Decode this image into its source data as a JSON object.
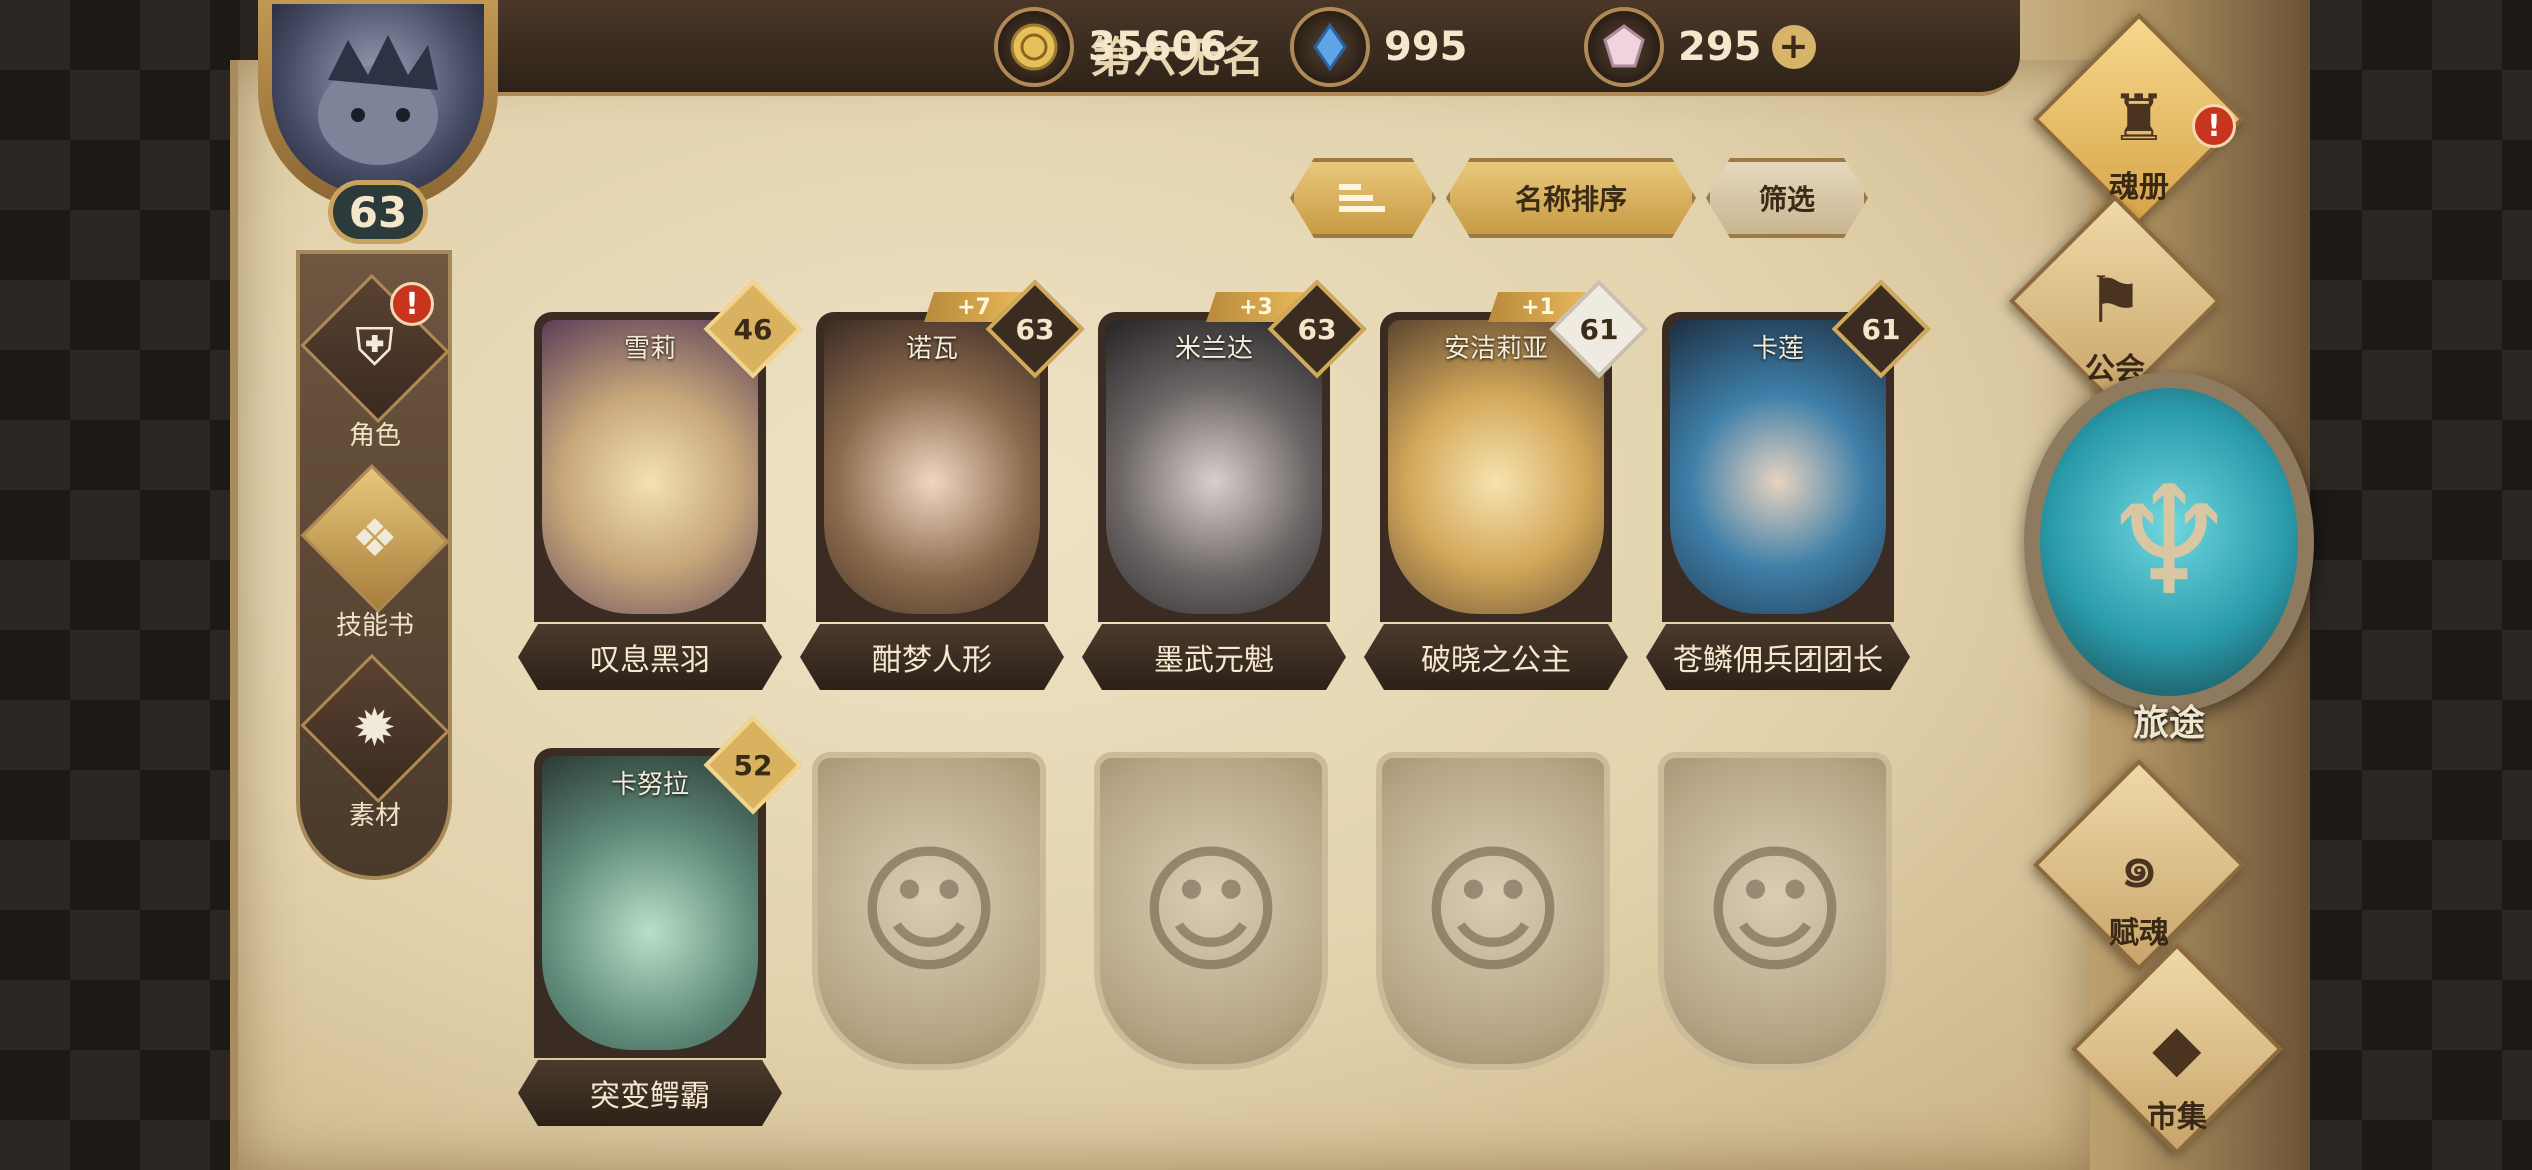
{
  "player": {
    "name": "第六无名",
    "level": "63"
  },
  "currencies": [
    {
      "icon": "gold-coin-icon",
      "value": "35606"
    },
    {
      "icon": "blue-crystal-icon",
      "value": "995"
    },
    {
      "icon": "pink-gem-icon",
      "value": "295"
    }
  ],
  "left_nav": [
    {
      "label": "角色",
      "icon": "helmet-icon",
      "alert": true
    },
    {
      "label": "技能书",
      "icon": "book-icon",
      "alert": false,
      "active": true
    },
    {
      "label": "素材",
      "icon": "beast-icon",
      "alert": false
    }
  ],
  "sort": {
    "name_sort": "名称排序",
    "filter": "筛选",
    "order_icon": "sort-order-icon"
  },
  "characters": [
    {
      "name": "雪莉",
      "title": "叹息黑羽",
      "level": "46",
      "plus": "",
      "badge": "gold"
    },
    {
      "name": "诺瓦",
      "title": "酣梦人形",
      "level": "63",
      "plus": "+7",
      "badge": "dark"
    },
    {
      "name": "米兰达",
      "title": "墨武元魁",
      "level": "63",
      "plus": "+3",
      "badge": "dark"
    },
    {
      "name": "安洁莉亚",
      "title": "破晓之公主",
      "level": "61",
      "plus": "+1",
      "badge": "silver"
    },
    {
      "name": "卡莲",
      "title": "苍鳞佣兵团团长",
      "level": "61",
      "plus": "",
      "badge": "dark"
    },
    {
      "name": "卡努拉",
      "title": "突变鳄霸",
      "level": "52",
      "plus": "",
      "badge": "gold"
    }
  ],
  "right_nav": {
    "soul_book": "魂册",
    "guild": "公会",
    "journey": "旅途",
    "endow": "赋魂",
    "market": "市集"
  },
  "colors": {
    "parchment": "#e2d2ac",
    "gold_accent": "#d6b46a",
    "alert_red": "#c8351f",
    "journey_teal": "#2a9bab"
  }
}
